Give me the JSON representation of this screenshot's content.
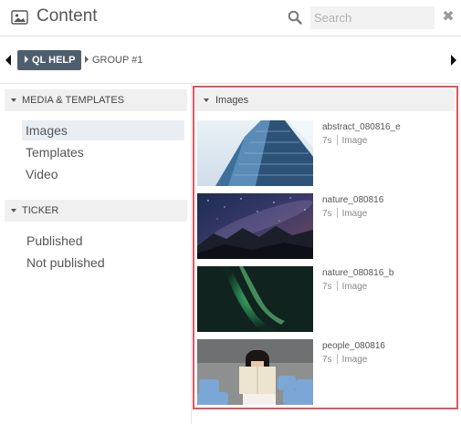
{
  "header": {
    "title": "Content",
    "search_placeholder": "Search"
  },
  "breadcrumb": {
    "active": "QL HELP",
    "group": "GROUP #1"
  },
  "sidebar": {
    "sections": [
      {
        "title": "MEDIA & TEMPLATES",
        "items": [
          "Images",
          "Templates",
          "Video"
        ],
        "selected": "Images"
      },
      {
        "title": "TICKER",
        "items": [
          "Published",
          "Not published"
        ]
      }
    ]
  },
  "main": {
    "section_title": "Images",
    "items": [
      {
        "name": "abstract_080816_e",
        "duration": "7s",
        "type": "Image"
      },
      {
        "name": "nature_080816",
        "duration": "7s",
        "type": "Image"
      },
      {
        "name": "nature_080816_b",
        "duration": "7s",
        "type": "Image"
      },
      {
        "name": "people_080816",
        "duration": "7s",
        "type": "Image"
      }
    ]
  },
  "colors": {
    "accent_dark": "#4f5e6d",
    "highlight_border": "#e05560",
    "selected_bg": "#e9eef3"
  }
}
